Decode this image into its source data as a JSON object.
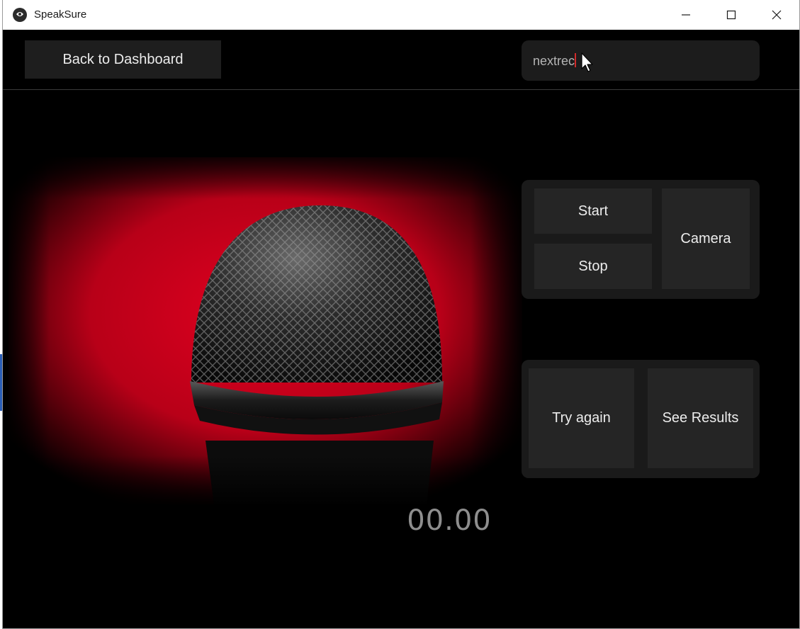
{
  "window": {
    "title": "SpeakSure",
    "icon": "speaksure-logo-icon",
    "controls": [
      "minimize-icon",
      "maximize-icon",
      "close-icon"
    ]
  },
  "toolbar": {
    "back_label": "Back to Dashboard",
    "name_input_value": "nextrec"
  },
  "media": {
    "image": "microphone-on-red-background"
  },
  "timer": {
    "value": "00.00"
  },
  "recording_controls": {
    "start_label": "Start",
    "stop_label": "Stop",
    "camera_label": "Camera"
  },
  "result_controls": {
    "try_again_label": "Try again",
    "see_results_label": "See Results"
  },
  "colors": {
    "background": "#000000",
    "button": "#252525",
    "panel": "#1a1a1a",
    "accent_red": "#c0001a",
    "text": "#ededed"
  }
}
